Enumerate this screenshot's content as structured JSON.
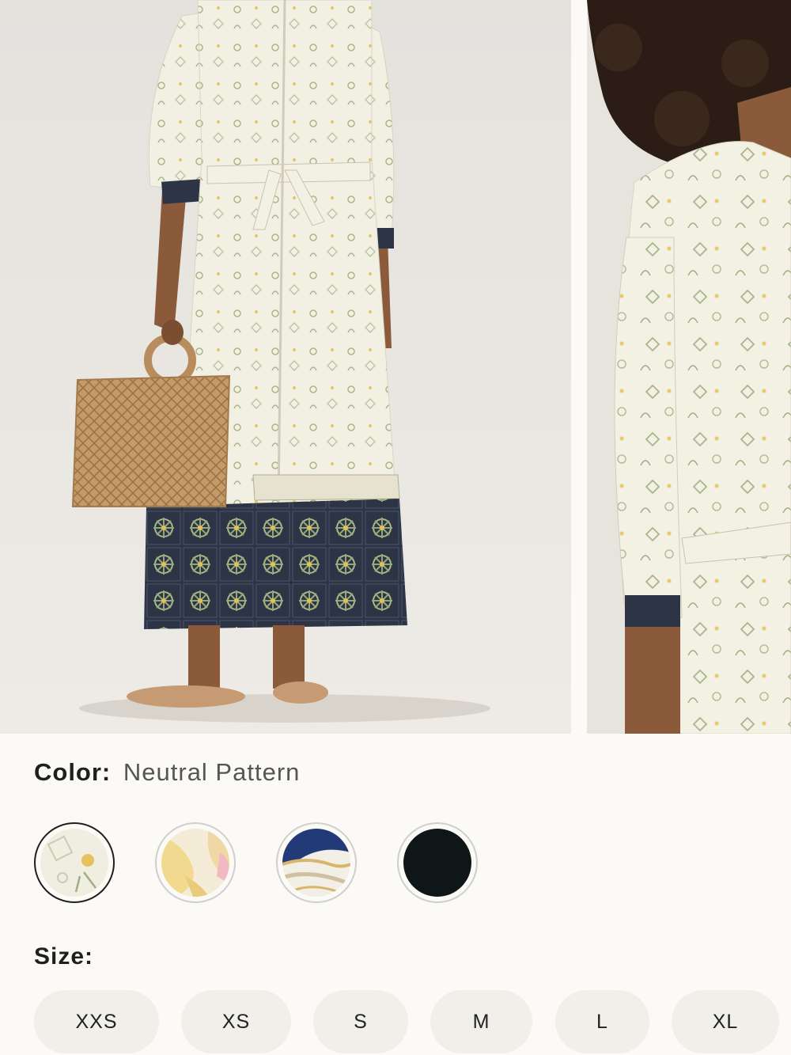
{
  "gallery": {
    "images": [
      {
        "name": "product-photo-full-length"
      },
      {
        "name": "product-photo-detail"
      }
    ]
  },
  "color": {
    "label": "Color:",
    "value": "Neutral Pattern",
    "swatches": [
      {
        "name": "neutral-pattern",
        "selected": true
      },
      {
        "name": "yellow-pink-pattern",
        "selected": false
      },
      {
        "name": "blue-marble-pattern",
        "selected": false
      },
      {
        "name": "black-solid",
        "selected": false
      }
    ]
  },
  "size": {
    "label": "Size:",
    "options": [
      "XXS",
      "XS",
      "S",
      "M",
      "L",
      "XL"
    ]
  },
  "colors": {
    "background": "#fbfaf6",
    "size_button_bg": "#f1efe9",
    "selected_ring": "#1f1f1f"
  }
}
